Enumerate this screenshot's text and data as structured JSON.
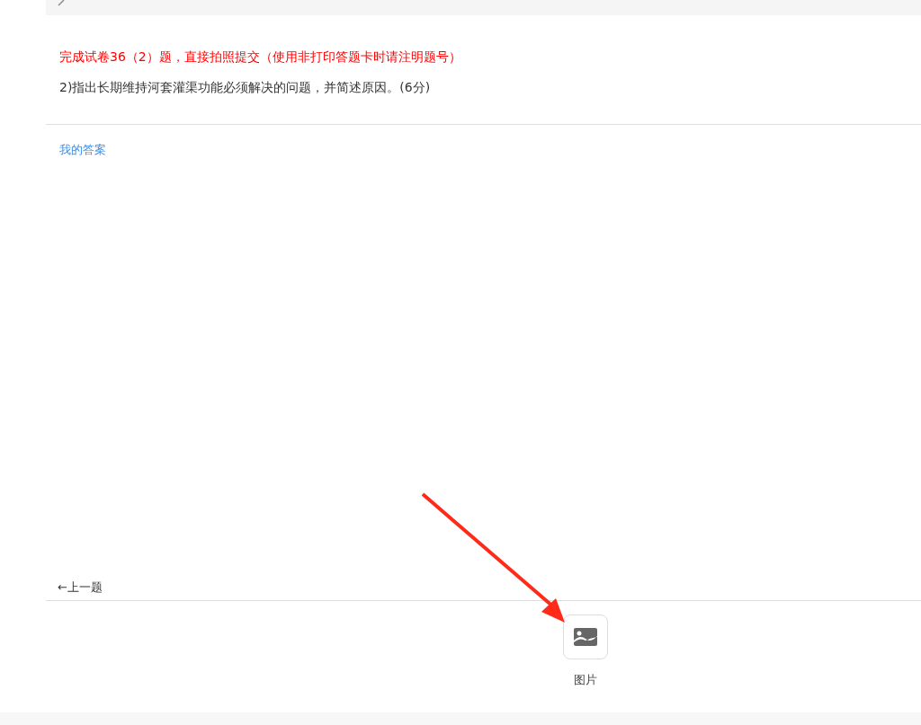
{
  "instruction": "完成试卷36（2）题，直接拍照提交（使用非打印答题卡时请注明题号）",
  "question": "2)指出长期维持河套灌渠功能必须解决的问题，并简述原因。(6分)",
  "answer_label": "我的答案",
  "prev_link": "←上一题",
  "upload": {
    "label": "图片"
  }
}
